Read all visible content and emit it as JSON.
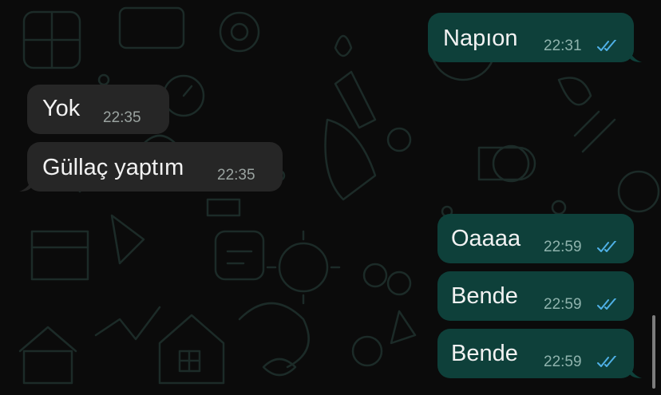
{
  "colors": {
    "background": "#0b0b0b",
    "outgoing_bubble": "#0e403a",
    "incoming_bubble": "#262626",
    "read_tick": "#4fb0e6"
  },
  "messages": [
    {
      "direction": "outgoing",
      "text": "Napıon",
      "time": "22:31",
      "status_icon": "double-check-read-icon"
    },
    {
      "direction": "incoming",
      "text": "Yok",
      "time": "22:35"
    },
    {
      "direction": "incoming",
      "text": "Güllaç yaptım",
      "time": "22:35"
    },
    {
      "direction": "outgoing",
      "text": "Oaaaa",
      "time": "22:59",
      "status_icon": "double-check-read-icon"
    },
    {
      "direction": "outgoing",
      "text": "Bende",
      "time": "22:59",
      "status_icon": "double-check-read-icon"
    },
    {
      "direction": "outgoing",
      "text": "Bende",
      "time": "22:59",
      "status_icon": "double-check-read-icon"
    }
  ]
}
